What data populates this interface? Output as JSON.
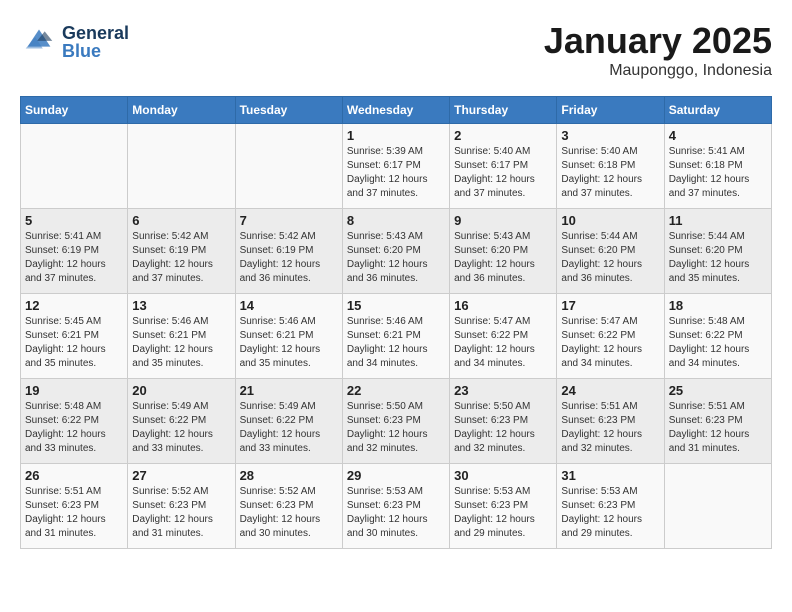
{
  "header": {
    "logo_general": "General",
    "logo_blue": "Blue",
    "month": "January 2025",
    "location": "Mauponggo, Indonesia"
  },
  "weekdays": [
    "Sunday",
    "Monday",
    "Tuesday",
    "Wednesday",
    "Thursday",
    "Friday",
    "Saturday"
  ],
  "weeks": [
    [
      {
        "day": "",
        "info": ""
      },
      {
        "day": "",
        "info": ""
      },
      {
        "day": "",
        "info": ""
      },
      {
        "day": "1",
        "info": "Sunrise: 5:39 AM\nSunset: 6:17 PM\nDaylight: 12 hours\nand 37 minutes."
      },
      {
        "day": "2",
        "info": "Sunrise: 5:40 AM\nSunset: 6:17 PM\nDaylight: 12 hours\nand 37 minutes."
      },
      {
        "day": "3",
        "info": "Sunrise: 5:40 AM\nSunset: 6:18 PM\nDaylight: 12 hours\nand 37 minutes."
      },
      {
        "day": "4",
        "info": "Sunrise: 5:41 AM\nSunset: 6:18 PM\nDaylight: 12 hours\nand 37 minutes."
      }
    ],
    [
      {
        "day": "5",
        "info": "Sunrise: 5:41 AM\nSunset: 6:19 PM\nDaylight: 12 hours\nand 37 minutes."
      },
      {
        "day": "6",
        "info": "Sunrise: 5:42 AM\nSunset: 6:19 PM\nDaylight: 12 hours\nand 37 minutes."
      },
      {
        "day": "7",
        "info": "Sunrise: 5:42 AM\nSunset: 6:19 PM\nDaylight: 12 hours\nand 36 minutes."
      },
      {
        "day": "8",
        "info": "Sunrise: 5:43 AM\nSunset: 6:20 PM\nDaylight: 12 hours\nand 36 minutes."
      },
      {
        "day": "9",
        "info": "Sunrise: 5:43 AM\nSunset: 6:20 PM\nDaylight: 12 hours\nand 36 minutes."
      },
      {
        "day": "10",
        "info": "Sunrise: 5:44 AM\nSunset: 6:20 PM\nDaylight: 12 hours\nand 36 minutes."
      },
      {
        "day": "11",
        "info": "Sunrise: 5:44 AM\nSunset: 6:20 PM\nDaylight: 12 hours\nand 35 minutes."
      }
    ],
    [
      {
        "day": "12",
        "info": "Sunrise: 5:45 AM\nSunset: 6:21 PM\nDaylight: 12 hours\nand 35 minutes."
      },
      {
        "day": "13",
        "info": "Sunrise: 5:46 AM\nSunset: 6:21 PM\nDaylight: 12 hours\nand 35 minutes."
      },
      {
        "day": "14",
        "info": "Sunrise: 5:46 AM\nSunset: 6:21 PM\nDaylight: 12 hours\nand 35 minutes."
      },
      {
        "day": "15",
        "info": "Sunrise: 5:46 AM\nSunset: 6:21 PM\nDaylight: 12 hours\nand 34 minutes."
      },
      {
        "day": "16",
        "info": "Sunrise: 5:47 AM\nSunset: 6:22 PM\nDaylight: 12 hours\nand 34 minutes."
      },
      {
        "day": "17",
        "info": "Sunrise: 5:47 AM\nSunset: 6:22 PM\nDaylight: 12 hours\nand 34 minutes."
      },
      {
        "day": "18",
        "info": "Sunrise: 5:48 AM\nSunset: 6:22 PM\nDaylight: 12 hours\nand 34 minutes."
      }
    ],
    [
      {
        "day": "19",
        "info": "Sunrise: 5:48 AM\nSunset: 6:22 PM\nDaylight: 12 hours\nand 33 minutes."
      },
      {
        "day": "20",
        "info": "Sunrise: 5:49 AM\nSunset: 6:22 PM\nDaylight: 12 hours\nand 33 minutes."
      },
      {
        "day": "21",
        "info": "Sunrise: 5:49 AM\nSunset: 6:22 PM\nDaylight: 12 hours\nand 33 minutes."
      },
      {
        "day": "22",
        "info": "Sunrise: 5:50 AM\nSunset: 6:23 PM\nDaylight: 12 hours\nand 32 minutes."
      },
      {
        "day": "23",
        "info": "Sunrise: 5:50 AM\nSunset: 6:23 PM\nDaylight: 12 hours\nand 32 minutes."
      },
      {
        "day": "24",
        "info": "Sunrise: 5:51 AM\nSunset: 6:23 PM\nDaylight: 12 hours\nand 32 minutes."
      },
      {
        "day": "25",
        "info": "Sunrise: 5:51 AM\nSunset: 6:23 PM\nDaylight: 12 hours\nand 31 minutes."
      }
    ],
    [
      {
        "day": "26",
        "info": "Sunrise: 5:51 AM\nSunset: 6:23 PM\nDaylight: 12 hours\nand 31 minutes."
      },
      {
        "day": "27",
        "info": "Sunrise: 5:52 AM\nSunset: 6:23 PM\nDaylight: 12 hours\nand 31 minutes."
      },
      {
        "day": "28",
        "info": "Sunrise: 5:52 AM\nSunset: 6:23 PM\nDaylight: 12 hours\nand 30 minutes."
      },
      {
        "day": "29",
        "info": "Sunrise: 5:53 AM\nSunset: 6:23 PM\nDaylight: 12 hours\nand 30 minutes."
      },
      {
        "day": "30",
        "info": "Sunrise: 5:53 AM\nSunset: 6:23 PM\nDaylight: 12 hours\nand 29 minutes."
      },
      {
        "day": "31",
        "info": "Sunrise: 5:53 AM\nSunset: 6:23 PM\nDaylight: 12 hours\nand 29 minutes."
      },
      {
        "day": "",
        "info": ""
      }
    ]
  ]
}
